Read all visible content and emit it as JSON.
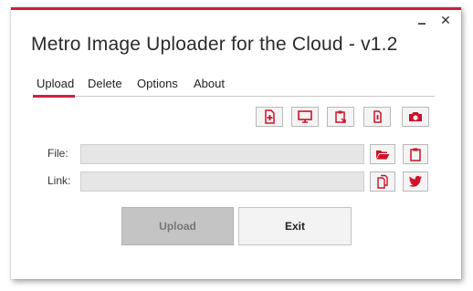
{
  "window": {
    "title": "Metro Image Uploader for the Cloud - v1.2",
    "minimize_icon": "minimize-icon",
    "close_label": "✕",
    "accent_color": "#cf1f3c"
  },
  "tabs": [
    {
      "label": "Upload",
      "active": true
    },
    {
      "label": "Delete",
      "active": false
    },
    {
      "label": "Options",
      "active": false
    },
    {
      "label": "About",
      "active": false
    }
  ],
  "toolbar": {
    "icons": [
      "add-file-icon",
      "screen-capture-icon",
      "clipboard-paste-icon",
      "copy-icon",
      "camera-icon"
    ]
  },
  "file": {
    "label": "File:",
    "value": "",
    "icons": [
      "folder-open-icon",
      "clipboard-icon"
    ]
  },
  "link": {
    "label": "Link:",
    "value": "",
    "icons": [
      "copy-link-icon",
      "twitter-icon"
    ]
  },
  "actions": {
    "upload_label": "Upload",
    "exit_label": "Exit"
  }
}
